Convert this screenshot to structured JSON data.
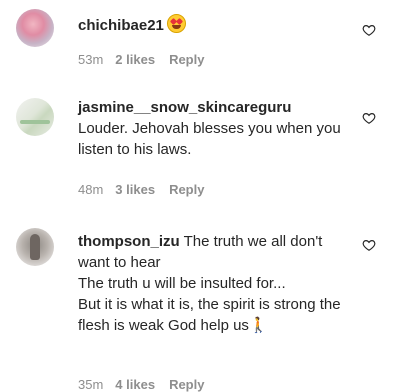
{
  "comments": [
    {
      "username": "chichibae21",
      "text": "",
      "emoji": "heart-eyes-emoji",
      "time": "53m",
      "likes": "2 likes",
      "reply": "Reply"
    },
    {
      "username": "jasmine__snow_skincareguru",
      "text": "Louder. Jehovah blesses you when you listen to his laws.",
      "time": "48m",
      "likes": "3 likes",
      "reply": "Reply"
    },
    {
      "username": "thompson_izu",
      "text": "The truth we all don't want to hear\nThe truth u will be insulted for...\nBut it is what it is, the spirit is strong the flesh is weak God help us",
      "emoji_end": "🚶",
      "time": "35m",
      "likes": "4 likes",
      "reply": "Reply"
    }
  ],
  "colors": {
    "text": "#262626",
    "meta": "#8e8e8e",
    "background": "#ffffff"
  }
}
